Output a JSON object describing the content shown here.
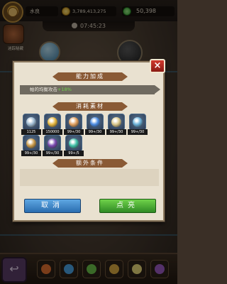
{
  "hud": {
    "player_name": "水良",
    "gold": "3,789,413,275",
    "gems": "50,398",
    "timer": "07:45:23",
    "side_button_label": "迷踪秘藏"
  },
  "modal": {
    "ability_title": "能力加成",
    "stat_text_prefix": "帕的均衡攻击",
    "stat_value": "+18%",
    "materials_title": "消耗素材",
    "extra_title": "额外条件",
    "cancel_label": "取消",
    "confirm_label": "点亮"
  },
  "materials": [
    {
      "count": "1125",
      "color": "#9bb8d0"
    },
    {
      "count": "150000",
      "color": "#e6b840"
    },
    {
      "count": "99+/30",
      "color": "#e0a060"
    },
    {
      "count": "99+/30",
      "color": "#4a8ae0"
    },
    {
      "count": "99+/30",
      "color": "#d9c78a"
    },
    {
      "count": "99+/30",
      "color": "#6ab0d8"
    },
    {
      "count": "99+/30",
      "color": "#c89a4a"
    },
    {
      "count": "99+/30",
      "color": "#7a4ab0"
    },
    {
      "count": "99+/5",
      "color": "#40c0a8"
    }
  ],
  "colors": {
    "accent_header": "#8a5a35",
    "stat_value_green": "#6fd24a",
    "cancel_blue": "#2a6db0",
    "confirm_green": "#2f8a24",
    "close_red": "#d23a2e"
  }
}
